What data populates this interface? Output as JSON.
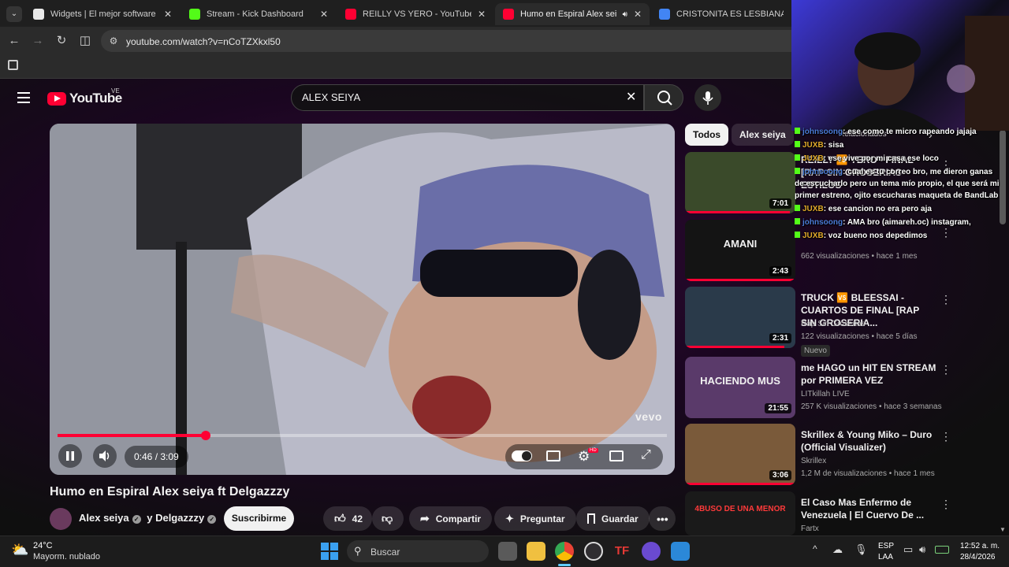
{
  "browser": {
    "tabs": [
      {
        "title": "Widgets | El mejor software par",
        "favicon_color": "#e9e9e9"
      },
      {
        "title": "Stream - Kick Dashboard",
        "favicon_color": "#53fc18"
      },
      {
        "title": "REILLY VS YERO - YouTube",
        "favicon_color": "#ff0033"
      },
      {
        "title": "Humo en Espiral Alex seiya",
        "favicon_color": "#ff0033"
      },
      {
        "title": "CRISTONITA ES LESBIANA - Bus",
        "favicon_color": "#4285f4"
      }
    ],
    "close_glyph": "✕",
    "url": "youtube.com/watch?v=nCoTZXkxl50",
    "icons": [
      "tab-search-icon",
      "back-icon",
      "forward-icon",
      "reload-icon",
      "split-view-icon",
      "site-info-icon",
      "apps-icon"
    ]
  },
  "youtube": {
    "logo_text": "YouTube",
    "region": "VE",
    "search": {
      "value": "ALEX SEIYA",
      "clear": "✕"
    },
    "player": {
      "time_current": "0:46",
      "time_total": "3:09",
      "time_display": "0:46 / 3:09",
      "progress_fraction": 0.243,
      "watermark": "vevo",
      "hd_badge": "HD"
    },
    "video": {
      "title": "Humo en Espiral Alex seiya ft Delgazzzy",
      "channels": [
        "Alex seiya",
        "y Delgazzzy"
      ],
      "subscribe_label": "Suscribirme",
      "likes": "42",
      "share_label": "Compartir",
      "ask_label": "Preguntar",
      "save_label": "Guardar"
    },
    "chips": [
      "Todos",
      "Alex seiya"
    ],
    "recommendations": [
      {
        "title": "REILLY 🆚 YERO - FINAL [RAP SIN GROSERIAS ESTILOS",
        "meta1": "",
        "meta2": "",
        "duration": "7:01",
        "progress": 0.95,
        "thumb": "#3a4a2a"
      },
      {
        "title": "",
        "meta1": "",
        "meta2": "662 visualizaciones • hace 1 mes",
        "duration": "2:43",
        "progress": 1.0,
        "thumb": "#141414",
        "thumb_text": "AMANI"
      },
      {
        "title": "TRUCK 🆚 BLEESSAI - CUARTOS DE FINAL [RAP SIN GROSERIA...",
        "meta1": "Rap Sin Groserias",
        "meta2": "122 visualizaciones • hace 5 días",
        "badge": "Nuevo",
        "duration": "2:31",
        "progress": 0.9,
        "thumb": "#2a3a4a"
      },
      {
        "title": "me HAGO un HIT EN STREAM por PRIMERA VEZ",
        "meta1": "LITkillah LIVE",
        "meta2": "257 K visualizaciones • hace 3 semanas",
        "duration": "21:55",
        "progress": 0.0,
        "thumb": "#5a3a6a",
        "thumb_text": "HACIENDO MUS"
      },
      {
        "title": "Skrillex & Young Miko – Duro (Official Visualizer)",
        "meta1": "Skrillex",
        "meta2": "1,2 M de visualizaciones • hace 1 mes",
        "duration": "3:06",
        "progress": 1.0,
        "thumb": "#7a5a3a"
      },
      {
        "title": "El Caso Mas Enfermo de Venezuela | El Cuervo De ...",
        "meta1": "Fartx",
        "meta2": "",
        "duration": "",
        "progress": 0.0,
        "thumb": "#1a1a1a",
        "thumb_text": "4BUSO DE UNA MENOR"
      }
    ],
    "more_glyph": "⋮"
  },
  "stream_overlay": {
    "chat": [
      {
        "user": "johnsoong",
        "text": ": ese como te micro rapeando jajaja",
        "user_color": "blue"
      },
      {
        "user": "JUXB",
        "text": ": sisa",
        "user_color": "orange"
      },
      {
        "user": "JUXB",
        "text": ": ese vive por mi casa ese loco",
        "user_color": "orange"
      },
      {
        "user": "johnsoong",
        "text": ": cual es tu correo bro, me dieron ganas de escucharlo pero un tema mío propio, el que será mi primer estreno, ojito escucharas maqueta de BandLab",
        "user_color": "blue"
      },
      {
        "user": "JUXB",
        "text": ": ese cancion no era pero aja",
        "user_color": "orange"
      },
      {
        "user": "johnsoong",
        "text": ": AMA bro (aimareh.oc) instagram,",
        "user_color": "blue"
      },
      {
        "user": "JUXB",
        "text": ": voz bueno nos depedimos",
        "user_color": "orange"
      }
    ],
    "related_label": "Relacionados"
  },
  "taskbar": {
    "weather_temp": "24°C",
    "weather_desc": "Mayorm. nublado",
    "search_placeholder": "Buscar",
    "lang_line1": "ESP",
    "lang_line2": "LAA",
    "time": "12:52 a. m.",
    "date": "28/4/2026"
  }
}
